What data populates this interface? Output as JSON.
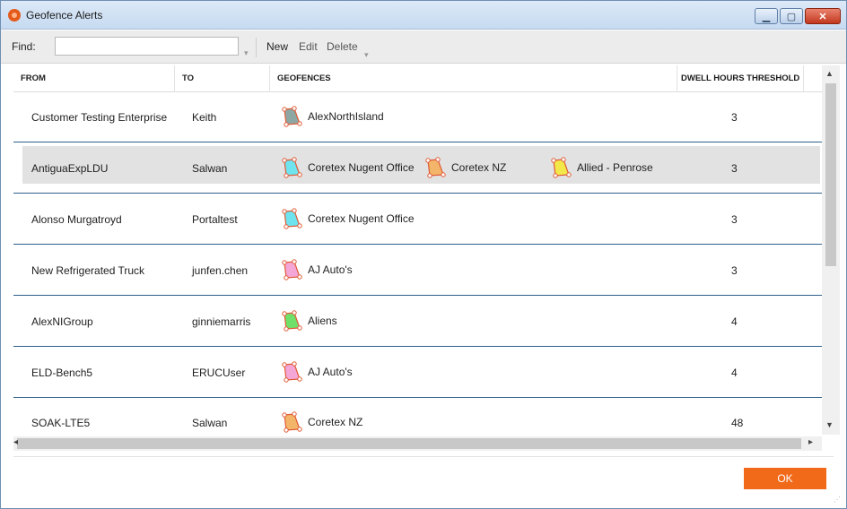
{
  "window": {
    "title": "Geofence Alerts"
  },
  "toolbar": {
    "find_label": "Find:",
    "find_value": "",
    "find_placeholder": "",
    "new_label": "New",
    "edit_label": "Edit",
    "delete_label": "Delete"
  },
  "columns": {
    "from": "FROM",
    "to": "TO",
    "geofences": "GEOFENCES",
    "dwell": "DWELL HOURS THRESHOLD"
  },
  "rows": [
    {
      "from": "Customer Testing Enterprise",
      "to": "Keith",
      "geofences": [
        {
          "name": "AlexNorthIsland",
          "icon": "polygon-geofence-icon",
          "color": "#8fa7a3"
        }
      ],
      "dwell": "3"
    },
    {
      "from": "AntiguaExpLDU",
      "to": "Salwan",
      "selected": true,
      "geofences": [
        {
          "name": "Coretex Nugent Office",
          "icon": "polygon-geofence-icon",
          "color": "#6fe3ee"
        },
        {
          "name": "Coretex NZ",
          "icon": "polygon-geofence-icon",
          "color": "#f3b56a"
        },
        {
          "name": "Allied - Penrose",
          "icon": "polygon-geofence-icon",
          "color": "#f2e84a"
        }
      ],
      "dwell": "3"
    },
    {
      "from": "Alonso Murgatroyd",
      "to": "Portaltest",
      "geofences": [
        {
          "name": "Coretex Nugent Office",
          "icon": "polygon-geofence-icon",
          "color": "#6fe3ee"
        }
      ],
      "dwell": "3"
    },
    {
      "from": "New Refrigerated Truck",
      "to": "junfen.chen",
      "geofences": [
        {
          "name": "AJ Auto's",
          "icon": "polygon-geofence-icon",
          "color": "#f4a6d7"
        }
      ],
      "dwell": "3"
    },
    {
      "from": "AlexNIGroup",
      "to": "ginniemarris",
      "geofences": [
        {
          "name": "Aliens",
          "icon": "polygon-geofence-icon",
          "color": "#6fe06a"
        }
      ],
      "dwell": "4"
    },
    {
      "from": "ELD-Bench5",
      "to": "ERUCUser",
      "geofences": [
        {
          "name": "AJ Auto's",
          "icon": "polygon-geofence-icon",
          "color": "#f4a6d7"
        }
      ],
      "dwell": "4"
    },
    {
      "from": "SOAK-LTE5",
      "to": "Salwan",
      "geofences": [
        {
          "name": "Coretex NZ",
          "icon": "polygon-geofence-icon",
          "color": "#f3b56a"
        }
      ],
      "dwell": "48"
    }
  ],
  "footer": {
    "ok_label": "OK"
  },
  "colors": {
    "accent": "#f06a1a",
    "row_divider": "#2e5f8a",
    "selected_row": "#e2e2e2"
  }
}
